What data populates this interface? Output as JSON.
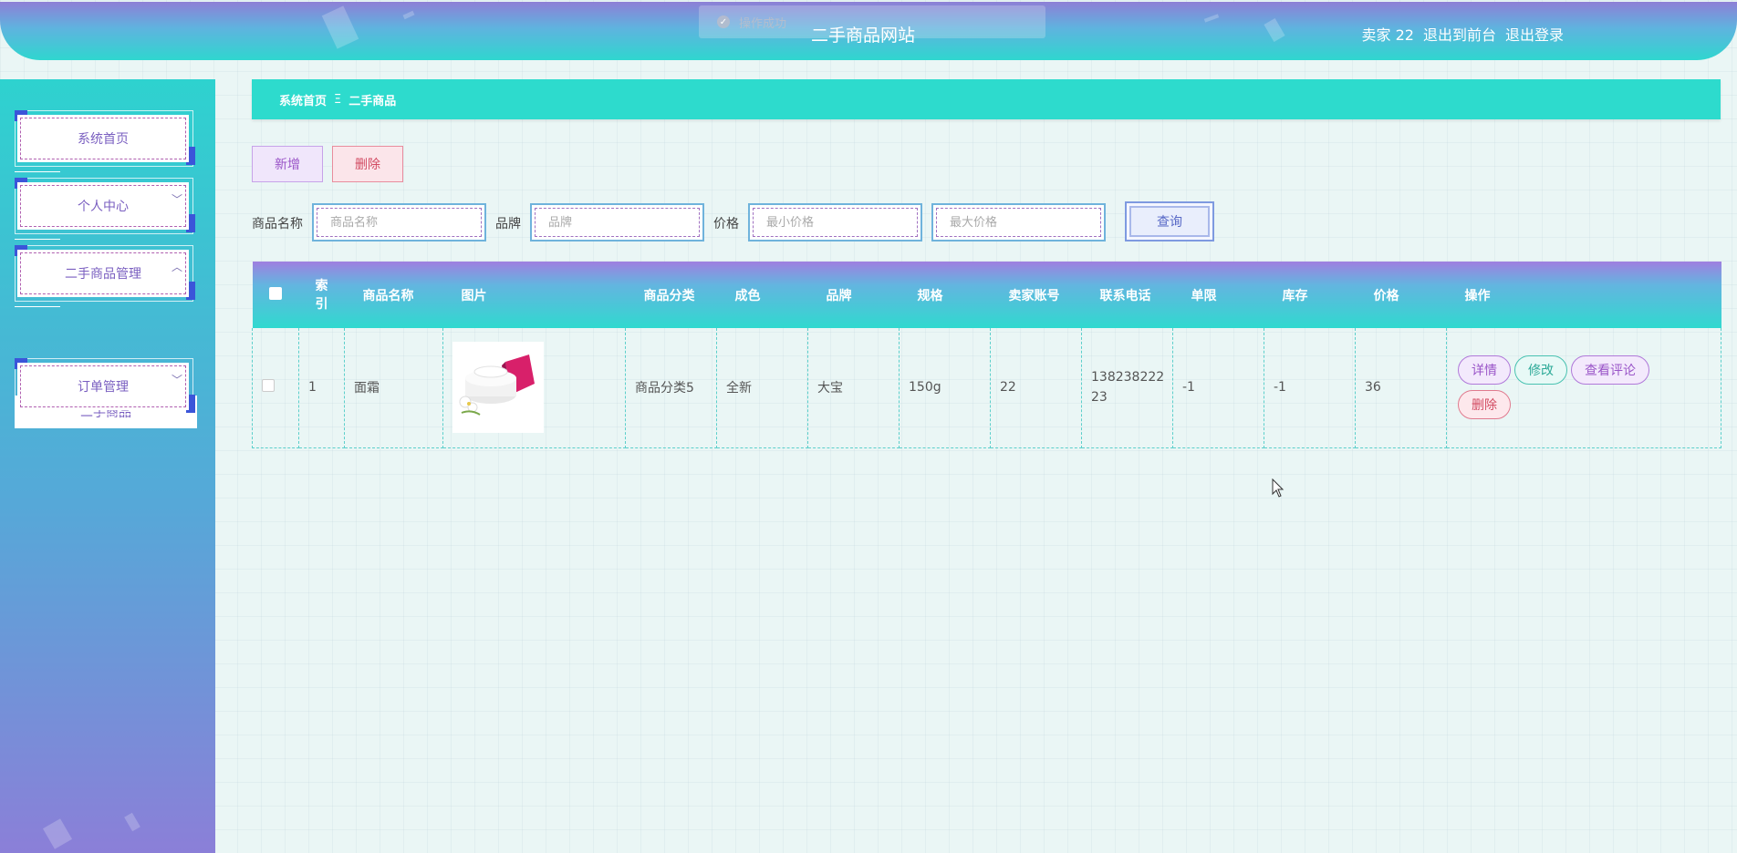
{
  "header": {
    "title": "二手商品网站",
    "toast": "操作成功",
    "user_label": "卖家 22",
    "go_front_label": "退出到前台",
    "logout_label": "退出登录"
  },
  "sidebar": {
    "items": [
      {
        "label": "系统首页"
      },
      {
        "label": "个人中心"
      },
      {
        "label": "二手商品管理"
      },
      {
        "label": "订单管理"
      }
    ],
    "sub_item": "二手商品"
  },
  "breadcrumb": {
    "home": "系统首页",
    "separator": "Ξ",
    "current": "二手商品"
  },
  "actions": {
    "add_label": "新增",
    "delete_label": "删除"
  },
  "search": {
    "name_label": "商品名称",
    "name_placeholder": "商品名称",
    "brand_label": "品牌",
    "brand_placeholder": "品牌",
    "price_label": "价格",
    "min_price_placeholder": "最小价格",
    "max_price_placeholder": "最大价格",
    "query_label": "查询"
  },
  "table": {
    "columns": [
      "索引",
      "商品名称",
      "图片",
      "商品分类",
      "成色",
      "品牌",
      "规格",
      "卖家账号",
      "联系电话",
      "单限",
      "库存",
      "价格",
      "操作"
    ],
    "rows": [
      {
        "index": "1",
        "name": "面霜",
        "category": "商品分类5",
        "condition": "全新",
        "brand": "大宝",
        "spec": "150g",
        "seller": "22",
        "phone": "13823822223",
        "limit": "-1",
        "stock": "-1",
        "price": "36"
      }
    ],
    "ops": {
      "detail": "详情",
      "edit": "修改",
      "review": "查看评论",
      "delete": "删除"
    }
  },
  "colors": {
    "accent_teal": "#2ddbcd",
    "accent_purple": "#9a55c8",
    "danger": "#d24b62"
  }
}
